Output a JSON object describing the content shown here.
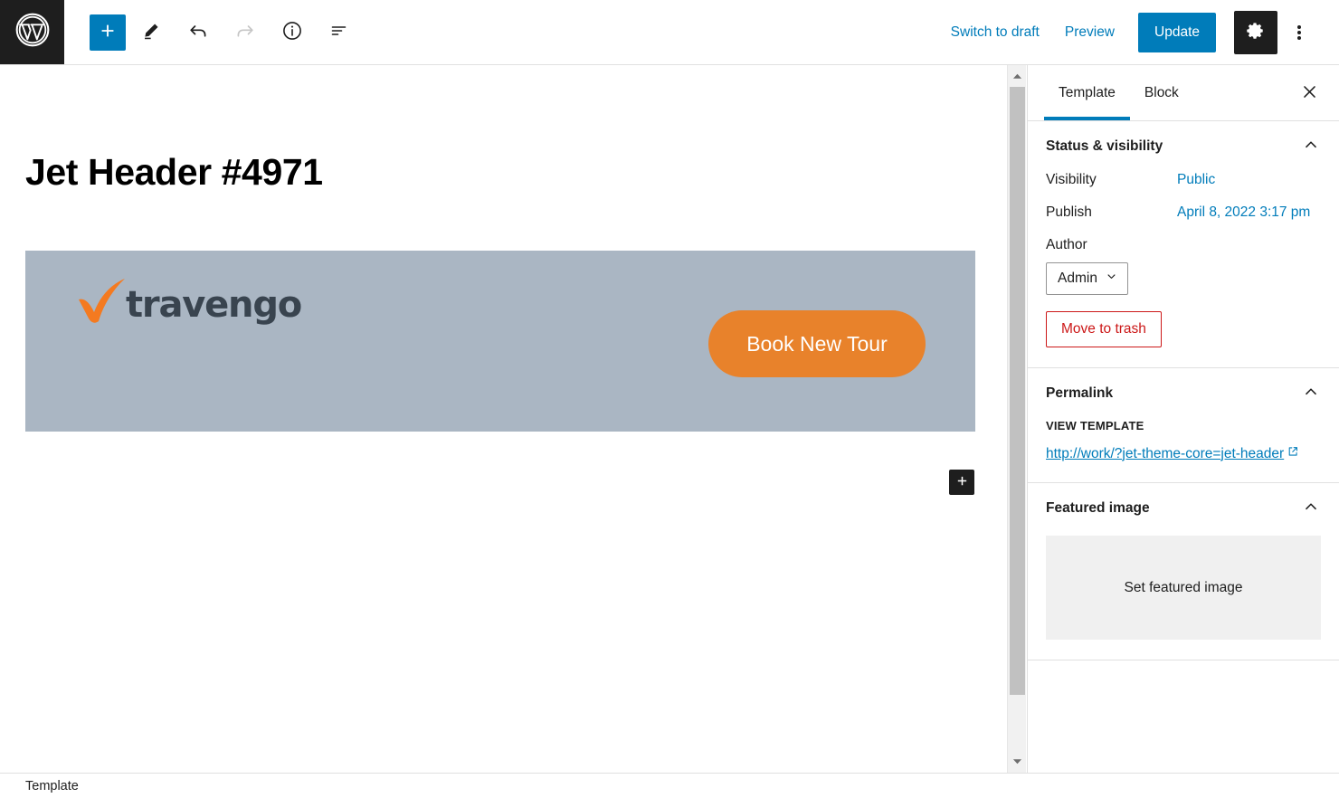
{
  "toolbar": {
    "wp_logo": "wordpress-logo",
    "add_block_label": "+",
    "icons": {
      "add": "plus-icon",
      "edit": "pencil-icon",
      "undo": "undo-arrow-icon",
      "redo": "redo-arrow-icon",
      "details": "info-circle-icon",
      "list_view": "list-view-icon"
    },
    "switch_to_draft": "Switch to draft",
    "preview": "Preview",
    "update": "Update",
    "settings_icon": "gear-icon",
    "options_icon": "kebab-menu-icon"
  },
  "editor": {
    "post_title": "Jet Header #4971",
    "header_block": {
      "background_color": "#aab6c3",
      "logo_text": "travengo",
      "logo_mark": "orange-checkmark-swoosh-icon",
      "logo_text_color": "#39444f",
      "logo_mark_color": "#f47a20",
      "cta_label": "Book New Tour",
      "cta_color": "#e8822b",
      "cta_text_color": "#ffffff"
    },
    "block_appender_label": "+"
  },
  "scrollbar": {
    "up_arrow": "scroll-up-arrow-icon",
    "down_arrow": "scroll-down-arrow-icon"
  },
  "sidebar": {
    "tabs": [
      {
        "label": "Template",
        "active": true
      },
      {
        "label": "Block",
        "active": false
      }
    ],
    "close_icon": "close-x-icon",
    "sections": {
      "status": {
        "title": "Status & visibility",
        "toggle_icon": "chevron-up-icon",
        "visibility_label": "Visibility",
        "visibility_value": "Public",
        "publish_label": "Publish",
        "publish_value": "April 8, 2022 3:17 pm",
        "author_label": "Author",
        "author_value": "Admin",
        "author_chevron": "chevron-down-icon",
        "trash_label": "Move to trash",
        "trash_color": "#cc1818"
      },
      "permalink": {
        "title": "Permalink",
        "toggle_icon": "chevron-up-icon",
        "view_label": "VIEW TEMPLATE",
        "url": "http://work/?jet-theme-core=jet-header",
        "external_icon": "external-link-icon"
      },
      "featured_image": {
        "title": "Featured image",
        "toggle_icon": "chevron-up-icon",
        "placeholder_label": "Set featured image"
      }
    }
  },
  "footer": {
    "breadcrumb": "Template"
  },
  "colors": {
    "accent": "#007cba",
    "dark": "#1e1e1e",
    "danger": "#cc1818"
  }
}
